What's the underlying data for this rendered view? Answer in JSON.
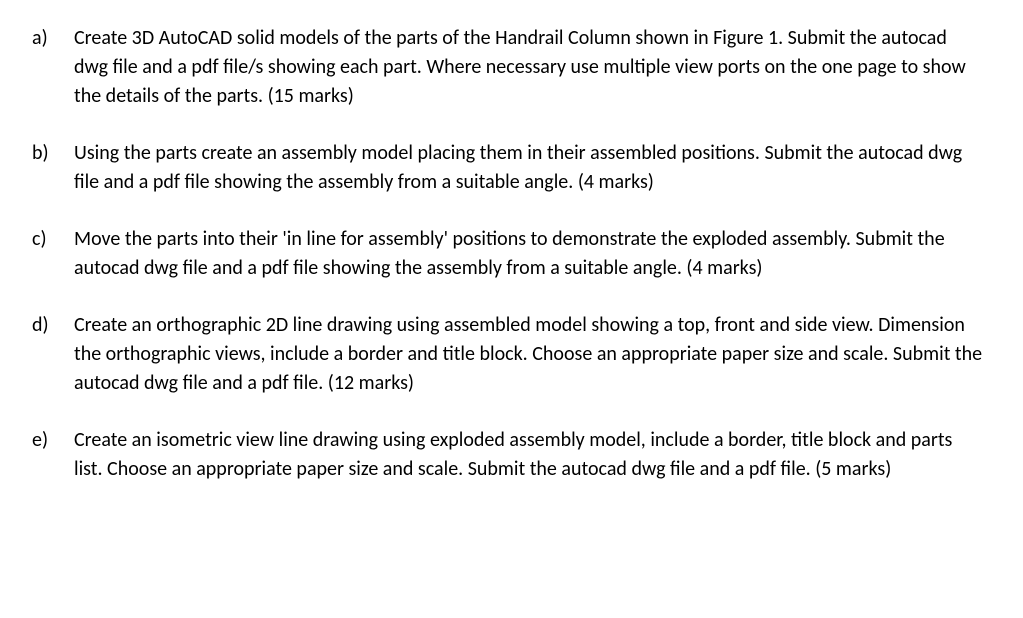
{
  "items": [
    {
      "marker": "a)",
      "text": "Create 3D AutoCAD solid models of the parts of the Handrail Column shown in Figure 1. Submit the autocad dwg file and a pdf file/s showing each part. Where necessary use multiple view ports on the one page to show the details of the parts. (15 marks)"
    },
    {
      "marker": "b)",
      "text": "Using the parts create an assembly model placing them in their assembled positions. Submit the autocad dwg file and a pdf file showing the assembly from a suitable angle. (4 marks)"
    },
    {
      "marker": "c)",
      "text": "Move the parts into their 'in line for assembly' positions to demonstrate the exploded assembly. Submit the autocad dwg file and a pdf file showing the assembly from a suitable angle. (4 marks)"
    },
    {
      "marker": "d)",
      "text": "Create an orthographic 2D line drawing using assembled model showing a top, front and side view. Dimension the orthographic views, include a border and title block. Choose an appropriate paper size and scale. Submit the autocad dwg file and a pdf file. (12 marks)"
    },
    {
      "marker": "e)",
      "text": "Create an isometric view line drawing using exploded assembly model, include a border, title block and parts list. Choose an appropriate paper size and scale. Submit the autocad dwg file and a pdf file. (5 marks)"
    }
  ]
}
